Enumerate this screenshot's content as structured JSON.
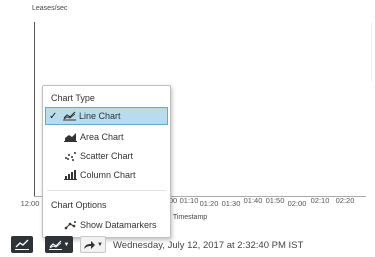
{
  "chart": {
    "y_axis_label": "Leases/sec",
    "x_axis_label": "Timestamp",
    "x_ticks": [
      {
        "label": "12:00",
        "sub": true
      },
      {
        "label": "00",
        "sub": false
      },
      {
        "label": "01:10",
        "sub": false
      },
      {
        "label": "01:20",
        "sub": true
      },
      {
        "label": "01:30",
        "sub": true
      },
      {
        "label": "01:40",
        "sub": false
      },
      {
        "label": "01:50",
        "sub": false
      },
      {
        "label": "02:00",
        "sub": true
      },
      {
        "label": "02:10",
        "sub": false
      },
      {
        "label": "02:20",
        "sub": false
      }
    ]
  },
  "menu": {
    "chart_type_heading": "Chart Type",
    "items": [
      {
        "label": "Line Chart",
        "icon": "line-chart-icon",
        "selected": true
      },
      {
        "label": "Area Chart",
        "icon": "area-chart-icon",
        "selected": false
      },
      {
        "label": "Scatter Chart",
        "icon": "scatter-chart-icon",
        "selected": false
      },
      {
        "label": "Column Chart",
        "icon": "column-chart-icon",
        "selected": false
      }
    ],
    "chart_options_heading": "Chart Options",
    "options": [
      {
        "label": "Show Datamarkers",
        "icon": "datamarkers-icon"
      }
    ]
  },
  "toolbar": {
    "timestamp": "Wednesday, July 12, 2017 at 2:32:40 PM IST"
  },
  "colors": {
    "selected_bg": "#b9dced",
    "toolbar_dark": "#2e3338"
  }
}
